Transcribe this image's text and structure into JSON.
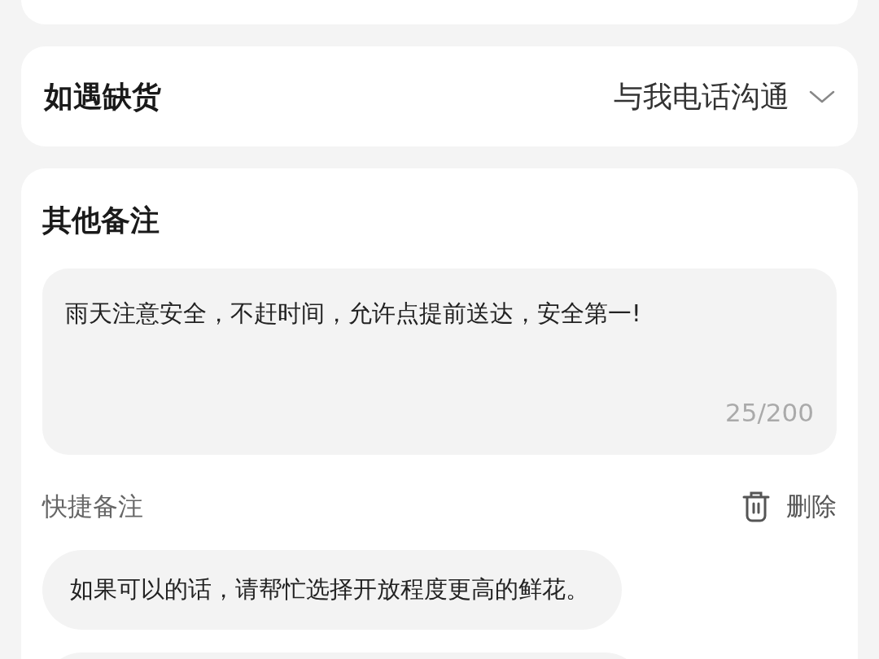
{
  "stockout": {
    "label": "如遇缺货",
    "value": "与我电话沟通"
  },
  "remarks": {
    "title": "其他备注",
    "value": "雨天注意安全，不赶时间，允许点提前送达，安全第一!",
    "counter": "25/200"
  },
  "quick_notes": {
    "label": "快捷备注",
    "delete_label": "删除",
    "items": [
      "如果可以的话，请帮忙选择开放程度更高的鲜花。"
    ]
  }
}
